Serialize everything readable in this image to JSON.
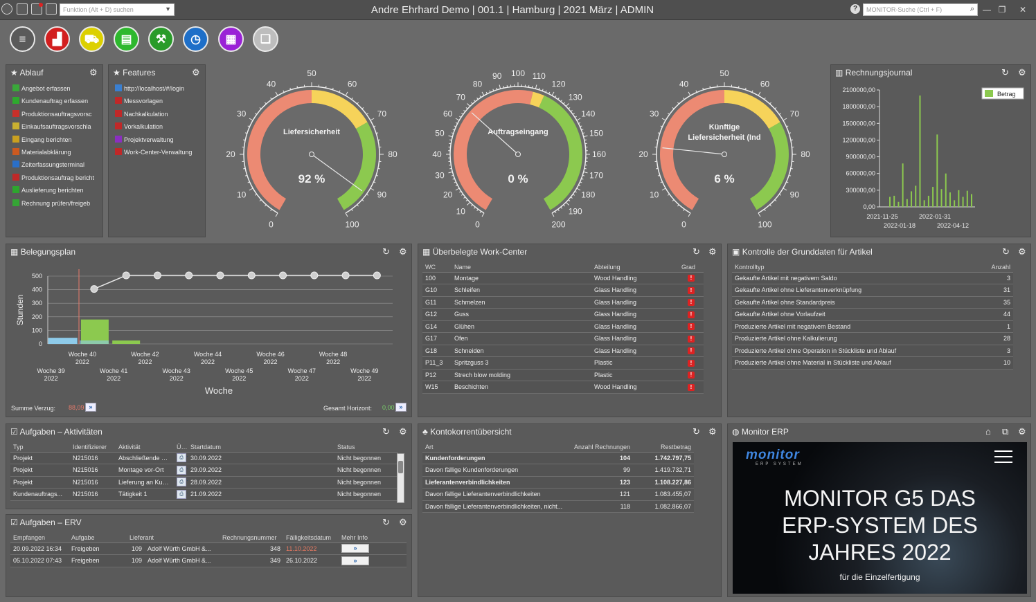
{
  "titlebar": {
    "function_search_placeholder": "Funktion (Alt + D) suchen",
    "title": "Andre Ehrhard Demo | 001.1 | Hamburg | 2021 März | ADMIN",
    "monitor_search_placeholder": "MONITOR-Suche (Ctrl + F)"
  },
  "toolbar": [
    {
      "name": "menu-icon",
      "color": "#eeeeee"
    },
    {
      "name": "factory-icon",
      "color": "#d21f1f"
    },
    {
      "name": "cart-icon",
      "color": "#dcd000"
    },
    {
      "name": "chart-briefcase-icon",
      "color": "#2eb82e"
    },
    {
      "name": "hand-truck-icon",
      "color": "#2a9b2a"
    },
    {
      "name": "clock-icon",
      "color": "#1e6fc8"
    },
    {
      "name": "calculator-icon",
      "color": "#9a22d6"
    },
    {
      "name": "copy-documents-icon",
      "color": "#bdbdbd"
    }
  ],
  "ablauf": {
    "title": "Ablauf",
    "items": [
      {
        "label": "Angebot erfassen",
        "color": "#3aa83a"
      },
      {
        "label": "Kundenauftrag erfassen",
        "color": "#2eaa2e"
      },
      {
        "label": "Produktionsauftragsvorsc",
        "color": "#c8302a"
      },
      {
        "label": "Einkaufsauftragsvorschla",
        "color": "#c9b030"
      },
      {
        "label": "Eingang berichten",
        "color": "#c9a020"
      },
      {
        "label": "Materialabklärung",
        "color": "#cc5a20"
      },
      {
        "label": "Zeiterfassungsterminal",
        "color": "#2a6fc8"
      },
      {
        "label": "Produktionsauftrag bericht",
        "color": "#c02828"
      },
      {
        "label": "Auslieferung berichten",
        "color": "#2ea52e"
      },
      {
        "label": "Rechnung prüfen/freigeb",
        "color": "#35a535"
      }
    ]
  },
  "features": {
    "title": "Features",
    "items": [
      {
        "label": "http://localhost/#/login",
        "color": "#3a7fd0"
      },
      {
        "label": "Messvorlagen",
        "color": "#c02828"
      },
      {
        "label": "Nachkalkulation",
        "color": "#c02828"
      },
      {
        "label": "Vorkalkulation",
        "color": "#c02828"
      },
      {
        "label": "Projektverwaltung",
        "color": "#8a2fc0"
      },
      {
        "label": "Work-Center-Verwaltung",
        "color": "#c02828"
      }
    ]
  },
  "gauges": [
    {
      "label_line1": "Liefersicherheit",
      "label_line2": "",
      "value_text": "92 %",
      "value": 92,
      "max": 100,
      "ticks": [
        "0",
        "10",
        "20",
        "30",
        "40",
        "50",
        "60",
        "70",
        "80",
        "90",
        "100"
      ]
    },
    {
      "label_line1": "Auftragseingang",
      "label_line2": "",
      "value_text": "0 %",
      "value": 68,
      "max": 200,
      "ticks": [
        "0",
        "10",
        "20",
        "30",
        "40",
        "50",
        "60",
        "70",
        "80",
        "90",
        "100",
        "110",
        "120",
        "130",
        "140",
        "150",
        "160",
        "170",
        "180",
        "190",
        "200"
      ]
    },
    {
      "label_line1": "Künftige",
      "label_line2": "Liefersicherheit (Ind",
      "value_text": "6 %",
      "value": 22,
      "max": 100,
      "ticks": [
        "0",
        "10",
        "20",
        "30",
        "40",
        "50",
        "60",
        "70",
        "80",
        "90",
        "100"
      ]
    }
  ],
  "rechnungsjournal": {
    "title": "Rechnungsjournal",
    "chart_data": {
      "type": "bar",
      "series": [
        {
          "name": "Betrag"
        }
      ],
      "yticks": [
        "2100000,00",
        "1800000,00",
        "1500000,00",
        "1200000,00",
        "900000,00",
        "600000,00",
        "300000,00",
        "0,00"
      ],
      "xticks_top": [
        "2021-11-25",
        "2022-01-31"
      ],
      "xticks_bottom": [
        "2022-01-18",
        "2022-04-12"
      ],
      "ylim": [
        0,
        2100000
      ],
      "values": [
        180000,
        200000,
        90000,
        780000,
        140000,
        280000,
        380000,
        2000000,
        120000,
        200000,
        360000,
        1300000,
        320000,
        600000,
        260000,
        120000,
        300000,
        180000,
        290000,
        230000
      ]
    }
  },
  "belegungsplan": {
    "title": "Belegungsplan",
    "chart_data": {
      "type": "bar",
      "ylabel": "Stunden",
      "xlabel": "Woche",
      "ylim": [
        0,
        500
      ],
      "yticks": [
        "500",
        "400",
        "300",
        "200",
        "100",
        "0"
      ],
      "categories_top": [
        {
          "line1": "Woche 40",
          "line2": "2022"
        },
        {
          "line1": "Woche 42",
          "line2": "2022"
        },
        {
          "line1": "Woche 44",
          "line2": "2022"
        },
        {
          "line1": "Woche 46",
          "line2": "2022"
        },
        {
          "line1": "Woche 48",
          "line2": "2022"
        }
      ],
      "categories_bottom": [
        {
          "line1": "Woche 39",
          "line2": "2022"
        },
        {
          "line1": "Woche 41",
          "line2": "2022"
        },
        {
          "line1": "Woche 43",
          "line2": "2022"
        },
        {
          "line1": "Woche 45",
          "line2": "2022"
        },
        {
          "line1": "Woche 47",
          "line2": "2022"
        },
        {
          "line1": "Woche 49",
          "line2": "2022"
        }
      ],
      "bars_blue": [
        45,
        25,
        0,
        0,
        0,
        0,
        0,
        0,
        0,
        0,
        0
      ],
      "bars_green": [
        0,
        180,
        25,
        0,
        0,
        0,
        0,
        0,
        0,
        0,
        0
      ],
      "line": [
        null,
        405,
        505,
        505,
        505,
        505,
        505,
        505,
        505,
        505,
        505
      ]
    },
    "summe_verzug_label": "Summe Verzug:",
    "summe_verzug_value": "88,09",
    "gesamt_horizont_label": "Gesamt Horizont:",
    "gesamt_horizont_value": "0,00"
  },
  "workcenter": {
    "title": "Überbelegte Work-Center",
    "headers": [
      "WC",
      "Name",
      "Abteilung",
      "Grad"
    ],
    "rows": [
      [
        "100",
        "Montage",
        "Wood Handling"
      ],
      [
        "G10",
        "Schleifen",
        "Glass Handling"
      ],
      [
        "G11",
        "Schmelzen",
        "Glass Handling"
      ],
      [
        "G12",
        "Guss",
        "Glass Handling"
      ],
      [
        "G14",
        "Glühen",
        "Glass Handling"
      ],
      [
        "G17",
        "Ofen",
        "Glass Handling"
      ],
      [
        "G18",
        "Schneiden",
        "Glass Handling"
      ],
      [
        "P11_3",
        "Spritzguss 3",
        "Plastic"
      ],
      [
        "P12",
        "Strech blow molding",
        "Plastic"
      ],
      [
        "W15",
        "Beschichten",
        "Wood Handling"
      ]
    ]
  },
  "grunddaten": {
    "title": "Kontrolle der Grunddaten für Artikel",
    "headers": [
      "Kontrolltyp",
      "Anzahl"
    ],
    "rows": [
      [
        "Gekaufte Artikel mit negativem Saldo",
        "3"
      ],
      [
        "Gekaufte Artikel ohne Lieferantenverknüpfung",
        "31"
      ],
      [
        "Gekaufte Artikel ohne Standardpreis",
        "35"
      ],
      [
        "Gekaufte Artikel ohne Vorlaufzeit",
        "44"
      ],
      [
        "Produzierte Artikel mit negativem Bestand",
        "1"
      ],
      [
        "Produzierte Artikel ohne Kalkulierung",
        "28"
      ],
      [
        "Produzierte Artikel ohne Operation in Stückliste und Ablauf",
        "3"
      ],
      [
        "Produzierte Artikel ohne Material in Stückliste und Ablauf",
        "10"
      ]
    ]
  },
  "aufgaben_akt": {
    "title": "Aufgaben – Aktivitäten",
    "headers": [
      "Typ",
      "Identifizierer",
      "Aktivität",
      "Üb.",
      "Startdatum",
      "Status"
    ],
    "rows": [
      [
        "Projekt",
        "N215016",
        "Abschließende Q...",
        "30.09.2022",
        "Nicht begonnen"
      ],
      [
        "Projekt",
        "N215016",
        "Montage vor-Ort",
        "29.09.2022",
        "Nicht begonnen"
      ],
      [
        "Projekt",
        "N215016",
        "Lieferung an Kun...",
        "28.09.2022",
        "Nicht begonnen"
      ],
      [
        "Kundenauftrags...",
        "N215016",
        "Tätigkeit 1",
        "21.09.2022",
        "Nicht begonnen"
      ]
    ]
  },
  "aufgaben_erv": {
    "title": "Aufgaben – ERV",
    "headers": [
      "Empfangen",
      "Aufgabe",
      "Lieferant",
      "Rechnungsnummer",
      "Fälligkeitsdatum",
      "Mehr Info"
    ],
    "rows": [
      {
        "empfangen": "20.09.2022 16:34",
        "aufgabe": "Freigeben",
        "lief_nr": "109",
        "lief_name": "Adolf Würth GmbH &...",
        "nummer": "348",
        "faellig": "11.10.2022",
        "overdue": true
      },
      {
        "empfangen": "05.10.2022 07:43",
        "aufgabe": "Freigeben",
        "lief_nr": "109",
        "lief_name": "Adolf Würth GmbH &...",
        "nummer": "349",
        "faellig": "26.10.2022",
        "overdue": false
      }
    ]
  },
  "konto": {
    "title": "Kontokorrentübersicht",
    "headers": [
      "Art",
      "Anzahl Rechnungen",
      "Restbetrag"
    ],
    "rows": [
      {
        "art": "Kundenforderungen",
        "anzahl": "104",
        "rest": "1.742.797,75",
        "bold": true
      },
      {
        "art": "Davon fällige Kundenforderungen",
        "anzahl": "99",
        "rest": "1.419.732,71",
        "bold": false
      },
      {
        "art": "Lieferantenverbindlichkeiten",
        "anzahl": "123",
        "rest": "1.108.227,86",
        "bold": true
      },
      {
        "art": "Davon fällige Lieferantenverbindlichkeiten",
        "anzahl": "121",
        "rest": "1.083.455,07",
        "bold": false
      },
      {
        "art": "Davon fällige Lieferantenverbindlichkeiten, nicht...",
        "anzahl": "118",
        "rest": "1.082.866,07",
        "bold": false
      }
    ]
  },
  "monitor": {
    "title": "Monitor ERP",
    "logo": "monitor",
    "logo_sub": "ERP SYSTEM",
    "headline1": "MONITOR G5 DAS",
    "headline2": "ERP-SYSTEM DES",
    "headline3": "JAHRES 2022",
    "subline": "für die Einzelfertigung"
  },
  "legend_betrag": "Betrag"
}
